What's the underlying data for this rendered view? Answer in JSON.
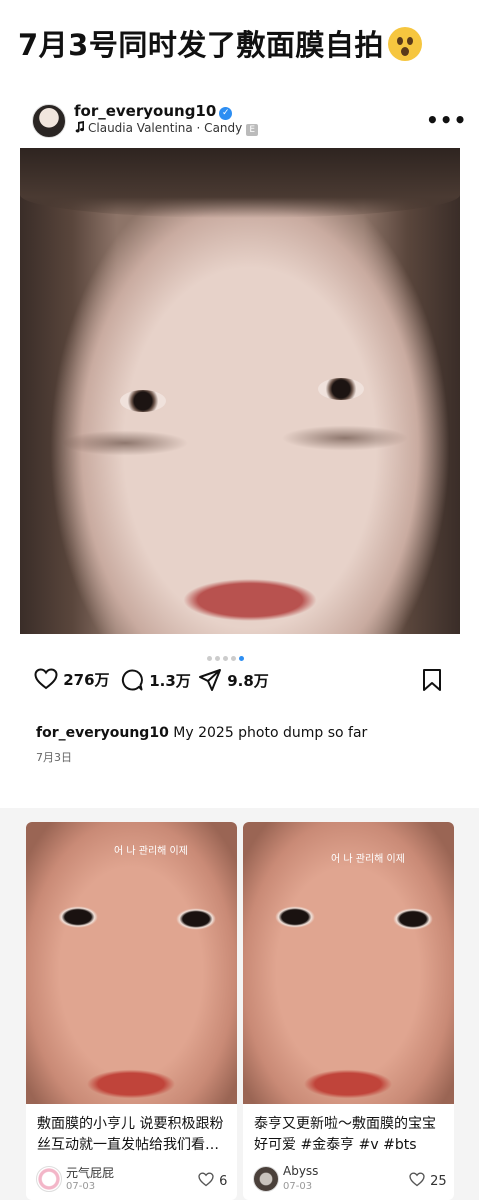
{
  "headline": "7月3号同时发了敷面膜自拍",
  "post": {
    "username": "for_everyoung10",
    "verified_mark": "✓",
    "music_note_icon": "music-note-icon",
    "music": "Claudia Valentina · Candy",
    "explicit_badge": "E",
    "more": "•••",
    "carousel_pages": 5,
    "carousel_active": 5,
    "likes": "276万",
    "comments": "1.3万",
    "shares": "9.8万",
    "caption_user": "for_everyoung10",
    "caption_text": " My 2025 photo dump so far",
    "date": "7月3日"
  },
  "feed": {
    "cards": [
      {
        "overlay_text": "어 나 관리해 이제",
        "text": "敷面膜的小亨儿 说要积极跟粉丝互动就一直发帖给我们看…",
        "author": "元气屁屁",
        "date": "07-03",
        "likes": "6"
      },
      {
        "overlay_text": "어 나 관리해 이제",
        "text": "泰亨又更新啦～敷面膜的宝宝好可爱 #金泰亨 #v #bts",
        "author": "Abyss",
        "date": "07-03",
        "likes": "25"
      }
    ]
  }
}
